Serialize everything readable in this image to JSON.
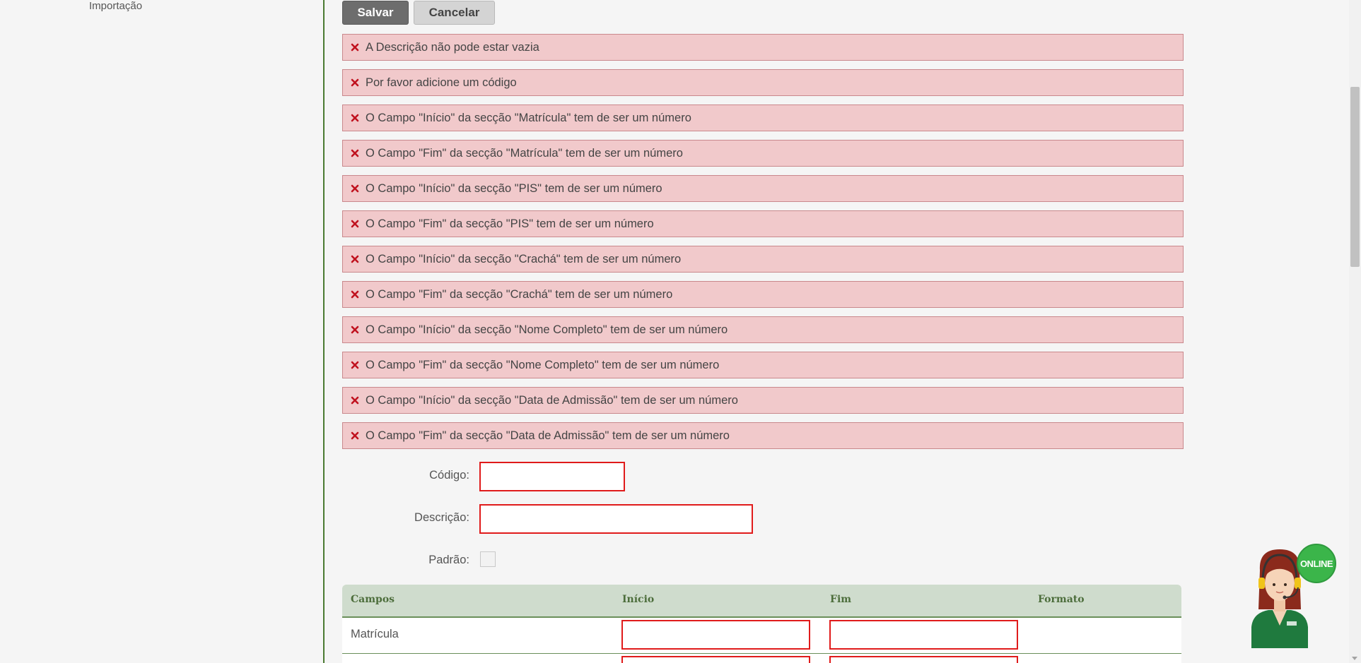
{
  "sidebar": {
    "items": [
      {
        "label": "Importação"
      }
    ]
  },
  "toolbar": {
    "save_label": "Salvar",
    "cancel_label": "Cancelar"
  },
  "errors": [
    "A Descrição não pode estar vazia",
    "Por favor adicione um código",
    "O Campo \"Início\" da secção \"Matrícula\" tem de ser um número",
    "O Campo \"Fim\" da secção \"Matrícula\" tem de ser um número",
    "O Campo \"Início\" da secção \"PIS\" tem de ser um número",
    "O Campo \"Fim\" da secção \"PIS\" tem de ser um número",
    "O Campo \"Início\" da secção \"Crachá\" tem de ser um número",
    "O Campo \"Fim\" da secção \"Crachá\" tem de ser um número",
    "O Campo \"Início\" da secção \"Nome Completo\" tem de ser um número",
    "O Campo \"Fim\" da secção \"Nome Completo\" tem de ser um número",
    "O Campo \"Início\" da secção \"Data de Admissão\" tem de ser um número",
    "O Campo \"Fim\" da secção \"Data de Admissão\" tem de ser um número"
  ],
  "form": {
    "codigo": {
      "label": "Código:",
      "value": ""
    },
    "descricao": {
      "label": "Descrição:",
      "value": ""
    },
    "padrao": {
      "label": "Padrão:",
      "checked": false
    }
  },
  "table": {
    "columns": [
      "Campos",
      "Início",
      "Fim",
      "Formato"
    ],
    "rows": [
      {
        "campo": "Matrícula",
        "inicio": "",
        "fim": "",
        "formato": ""
      }
    ]
  },
  "support": {
    "badge": "ONLINE"
  },
  "colors": {
    "error_bg": "#f1c9cb",
    "error_border": "#c9888c",
    "error_icon": "#c0121f",
    "invalid_border": "#e01b1b",
    "table_header_bg": "#cfdccd",
    "table_header_text": "#4d6e3c",
    "sidebar_border": "#4a7a32",
    "online_green": "#3bb54a"
  }
}
